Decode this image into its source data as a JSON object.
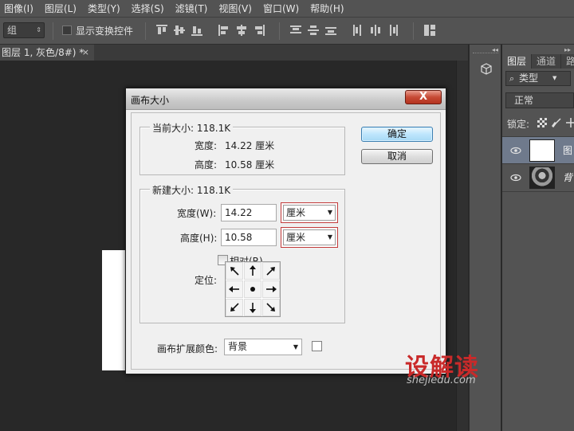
{
  "menu": [
    "图像(I)",
    "图层(L)",
    "类型(Y)",
    "选择(S)",
    "滤镜(T)",
    "视图(V)",
    "窗口(W)",
    "帮助(H)"
  ],
  "options_bar": {
    "group_select": "组",
    "show_transform_label": "显示变换控件"
  },
  "document_tab": {
    "title": "图层 1, 灰色/8#) *",
    "close": "×"
  },
  "layers_panel": {
    "tabs": [
      "图层",
      "通道",
      "路"
    ],
    "filter": "类型",
    "blend_mode": "正常",
    "lock_label": "锁定:",
    "layers": [
      {
        "name": "图",
        "selected": true
      },
      {
        "name": "背",
        "selected": false
      }
    ]
  },
  "dialog": {
    "title": "画布大小",
    "close": "X",
    "current_size": {
      "title": "当前大小: 118.1K",
      "width_label": "宽度:",
      "width_value": "14.22 厘米",
      "height_label": "高度:",
      "height_value": "10.58 厘米"
    },
    "new_size": {
      "title": "新建大小: 118.1K",
      "width_label": "宽度(W):",
      "width_value": "14.22",
      "width_unit": "厘米",
      "height_label": "高度(H):",
      "height_value": "10.58",
      "height_unit": "厘米",
      "relative_label": "相对(R)",
      "relative_checked": false,
      "anchor_label": "定位:"
    },
    "extension_color_label": "画布扩展颜色:",
    "extension_color_value": "背景",
    "ok_label": "确定",
    "cancel_label": "取消"
  },
  "watermark": {
    "logo_text": "设解读",
    "url": "shejiedu.com"
  },
  "colors": {
    "accent_close": "#c74a35",
    "ok_button": "#bee6fd",
    "unit_highlight": "#c23a3a",
    "watermark_red": "#c92a2a"
  }
}
